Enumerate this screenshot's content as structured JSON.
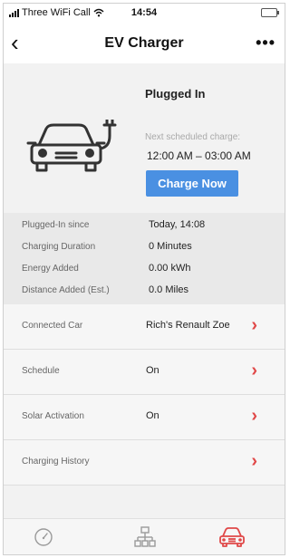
{
  "status_bar": {
    "carrier": "Three WiFi Call",
    "time": "14:54"
  },
  "nav": {
    "title": "EV Charger"
  },
  "charger": {
    "state": "Plugged In",
    "next_label": "Next scheduled charge:",
    "next_range": "12:00 AM – 03:00 AM",
    "charge_now_label": "Charge Now"
  },
  "stats": [
    {
      "label": "Plugged-In since",
      "value": "Today, 14:08"
    },
    {
      "label": "Charging Duration",
      "value": "0 Minutes"
    },
    {
      "label": "Energy Added",
      "value": "0.00 kWh"
    },
    {
      "label": "Distance Added (Est.)",
      "value": "0.0 Miles"
    }
  ],
  "rows": [
    {
      "label": "Connected Car",
      "value": "Rich's Renault Zoe"
    },
    {
      "label": "Schedule",
      "value": "On"
    },
    {
      "label": "Solar Activation",
      "value": "On"
    },
    {
      "label": "Charging History",
      "value": ""
    }
  ],
  "colors": {
    "accent_blue": "#4a90e2",
    "chevron_red": "#e04848",
    "active_tab": "#e04848"
  },
  "tabs": [
    {
      "icon": "gauge-icon",
      "active": false
    },
    {
      "icon": "network-icon",
      "active": false
    },
    {
      "icon": "car-icon",
      "active": true
    }
  ]
}
